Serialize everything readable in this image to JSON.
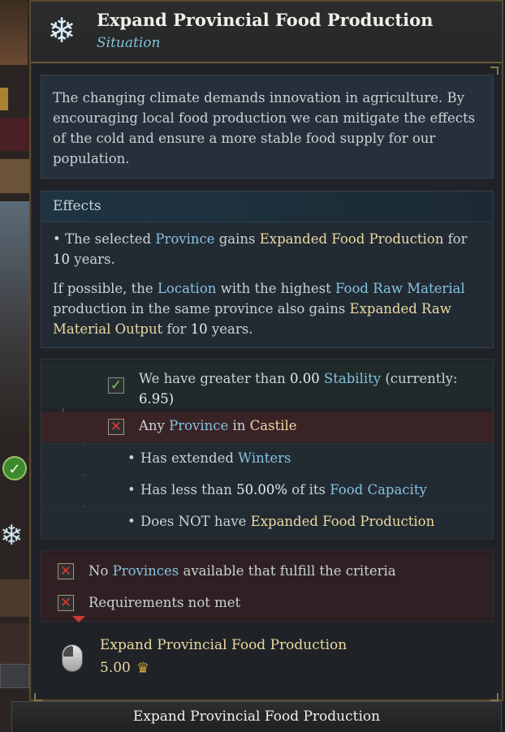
{
  "tooltip": {
    "title": "Expand Provincial Food Production",
    "subtitle": "Situation",
    "icon": "snowflake-icon",
    "description": "The changing climate demands innovation in agriculture. By encouraging local food production we can mitigate the effects of the cold and ensure a more stable food supply for our population.",
    "effects": {
      "heading": "Effects",
      "line1": {
        "pre": "• The selected ",
        "province": "Province",
        "mid": " gains ",
        "modifier": "Expanded Food Production",
        "post": " for ",
        "years": "10",
        "end": " years."
      },
      "line2": {
        "pre": "If possible, the ",
        "location": "Location",
        "mid1": " with the highest ",
        "resource": "Food Raw Material",
        "mid2": " production in the same province also gains ",
        "modifier": "Expanded Raw Material Output",
        "post": " for ",
        "years": "10",
        "end": " years."
      }
    },
    "requirements": [
      {
        "status": "met",
        "pre": "We have greater than ",
        "value": "0.00",
        "mid": " ",
        "term": "Stability",
        "post": " (currently:",
        "line2": "6.95)"
      },
      {
        "status": "failed",
        "pre": "Any ",
        "term": "Province",
        "mid": " in ",
        "target": "Castile"
      },
      {
        "pre": "Has extended ",
        "term": "Winters"
      },
      {
        "pre": "Has less than ",
        "value": "50.00%",
        "mid": " of its ",
        "term": "Food Capacity"
      },
      {
        "pre": "Does NOT have ",
        "target": "Expanded Food Production"
      }
    ],
    "status_rows": [
      {
        "pre": "No ",
        "term": "Provinces",
        "post": " available that fulfill the criteria"
      },
      {
        "text": "Requirements not met"
      }
    ],
    "action": {
      "title": "Expand Provincial Food Production",
      "cost": "5.00",
      "cost_icon": "crown-icon",
      "input_icon": "mouse-icon"
    }
  },
  "bottom_button": {
    "label": "Expand Provincial Food Production"
  },
  "colors": {
    "accent_blue": "#86c2e2",
    "accent_gold": "#ecd9a2",
    "ok_green": "#7fd04d",
    "fail_red": "#e2352d"
  }
}
